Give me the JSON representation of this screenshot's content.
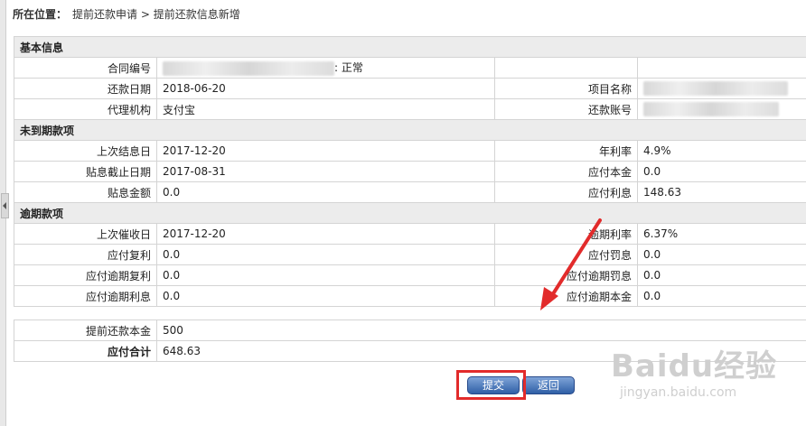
{
  "breadcrumb": {
    "prefix": "所在位置：",
    "path": "提前还款申请 > 提前还款信息新增"
  },
  "sections": {
    "basic": "基本信息",
    "not_due": "未到期款项",
    "overdue": "逾期款项"
  },
  "basic": {
    "contract_no_label": "合同编号",
    "contract_status": ": 正常",
    "repay_date_label": "还款日期",
    "repay_date": "2018-06-20",
    "project_name_label": "项目名称",
    "agency_label": "代理机构",
    "agency": "支付宝",
    "account_label": "还款账号"
  },
  "not_due": {
    "last_settle_label": "上次结息日",
    "last_settle": "2017-12-20",
    "annual_rate_label": "年利率",
    "annual_rate": "4.9%",
    "discount_end_label": "贴息截止日期",
    "discount_end": "2017-08-31",
    "principal_due_label": "应付本金",
    "principal_due": "0.0",
    "discount_amount_label": "贴息金额",
    "discount_amount": "0.0",
    "interest_due_label": "应付利息",
    "interest_due": "148.63"
  },
  "overdue": {
    "last_collect_label": "上次催收日",
    "last_collect": "2017-12-20",
    "overdue_rate_label": "逾期利率",
    "overdue_rate": "6.37%",
    "compound_label": "应付复利",
    "compound": "0.0",
    "penalty_label": "应付罚息",
    "penalty": "0.0",
    "overdue_compound_label": "应付逾期复利",
    "overdue_compound": "0.0",
    "overdue_penalty_label": "应付逾期罚息",
    "overdue_penalty": "0.0",
    "overdue_interest_label": "应付逾期利息",
    "overdue_interest": "0.0",
    "overdue_principal_label": "应付逾期本金",
    "overdue_principal": "0.0"
  },
  "summary": {
    "prepay_principal_label": "提前还款本金",
    "prepay_principal": "500",
    "total_label": "应付合计",
    "total": "648.63"
  },
  "buttons": {
    "submit": "提交",
    "back": "返回"
  },
  "watermark": {
    "brand": "Baidu经验",
    "url": "jingyan.baidu.com"
  },
  "colors": {
    "highlight": "#e22b2b",
    "arrow": "#e22b2b",
    "button": "#2f5fa6",
    "section_bg": "#ececec"
  }
}
